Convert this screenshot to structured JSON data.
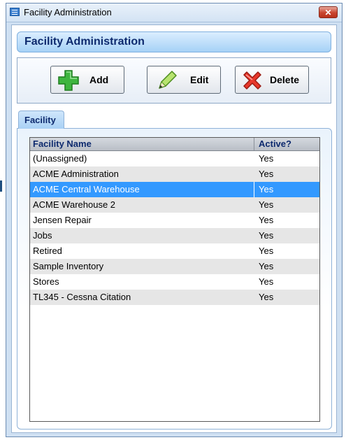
{
  "window": {
    "title": "Facility Administration",
    "close_glyph": "✕"
  },
  "header": {
    "title": "Facility Administration"
  },
  "toolbar": {
    "add_label": "Add",
    "edit_label": "Edit",
    "delete_label": "Delete"
  },
  "tab": {
    "label": "Facility"
  },
  "grid": {
    "columns": [
      "Facility Name",
      "Active?"
    ],
    "rows": [
      {
        "name": "(Unassigned)",
        "active": "Yes"
      },
      {
        "name": "ACME Administration",
        "active": "Yes"
      },
      {
        "name": "ACME Central Warehouse",
        "active": "Yes",
        "selected": true
      },
      {
        "name": "ACME Warehouse 2",
        "active": "Yes"
      },
      {
        "name": "Jensen Repair",
        "active": "Yes"
      },
      {
        "name": "Jobs",
        "active": "Yes"
      },
      {
        "name": "Retired",
        "active": "Yes"
      },
      {
        "name": "Sample Inventory",
        "active": "Yes"
      },
      {
        "name": "Stores",
        "active": "Yes"
      },
      {
        "name": "TL345 - Cessna Citation",
        "active": "Yes"
      }
    ]
  },
  "colors": {
    "selection": "#3399ff",
    "header_text": "#0d2a6e",
    "alt_row": "#e6e6e6"
  }
}
